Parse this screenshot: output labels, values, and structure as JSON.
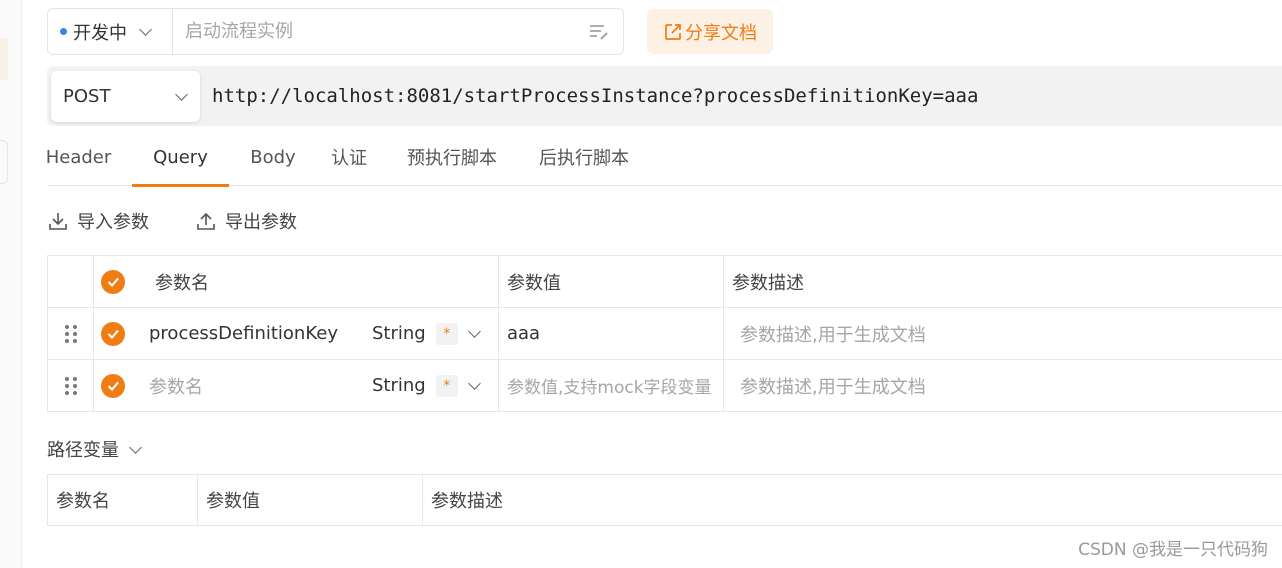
{
  "toolbar": {
    "status_label": "开发中",
    "status_dot_color": "#3b82f6",
    "name_placeholder": "启动流程实例",
    "share_label": "分享文档"
  },
  "request": {
    "method": "POST",
    "url": "http://localhost:8081/startProcessInstance?processDefinitionKey=aaa"
  },
  "tabs": [
    {
      "label": "Header",
      "active": false
    },
    {
      "label": "Query",
      "active": true
    },
    {
      "label": "Body",
      "active": false
    },
    {
      "label": "认证",
      "active": false
    },
    {
      "label": "预执行脚本",
      "active": false
    },
    {
      "label": "后执行脚本",
      "active": false
    }
  ],
  "actions": {
    "import_label": "导入参数",
    "export_label": "导出参数"
  },
  "params_table": {
    "headers": {
      "name": "参数名",
      "value": "参数值",
      "description": "参数描述"
    },
    "rows": [
      {
        "name": "processDefinitionKey",
        "type": "String",
        "required_mark": "*",
        "value": "aaa",
        "description_placeholder": "参数描述,用于生成文档"
      },
      {
        "name_placeholder": "参数名",
        "type": "String",
        "required_mark": "*",
        "value_placeholder": "参数值,支持mock字段变量",
        "description_placeholder": "参数描述,用于生成文档"
      }
    ]
  },
  "path_variables": {
    "title": "路径变量",
    "headers": {
      "name": "参数名",
      "value": "参数值",
      "description": "参数描述"
    }
  },
  "watermark": "CSDN @我是一只代码狗",
  "colors": {
    "accent": "#f07c14",
    "accent_bg": "#fdf1e6",
    "url_bar_bg": "#f2f2f2"
  }
}
